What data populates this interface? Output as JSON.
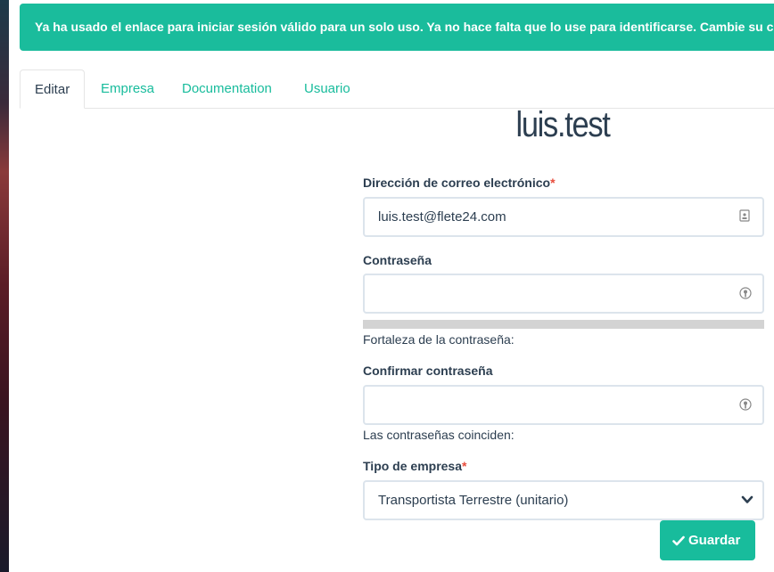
{
  "alert": {
    "text": "Ya ha usado el enlace para iniciar sesión válido para un solo uso. Ya no hace falta que lo use para identificarse. Cambie su clave, po"
  },
  "tabs": [
    {
      "label": "Editar",
      "active": true
    },
    {
      "label": "Empresa",
      "active": false
    },
    {
      "label": "Documentation",
      "active": false
    },
    {
      "label": "Usuario",
      "active": false
    }
  ],
  "page_title": "luis.test",
  "form": {
    "email": {
      "label": "Dirección de correo electrónico",
      "required_mark": "*",
      "value": "luis.test@flete24.com",
      "icon": "contact-card-icon"
    },
    "password": {
      "label": "Contraseña",
      "value": "",
      "icon": "password-key-icon",
      "strength_label": "Fortaleza de la contraseña:",
      "strength": 0
    },
    "confirm_password": {
      "label": "Confirmar contraseña",
      "value": "",
      "icon": "password-key-icon",
      "match_label": "Las contraseñas coinciden:"
    },
    "company_type": {
      "label": "Tipo de empresa",
      "required_mark": "*",
      "selected": "Transportista Terrestre (unitario)",
      "icon": "chevron-down-icon"
    }
  },
  "save_button": {
    "label": "Guardar",
    "icon": "checkmark-icon"
  },
  "colors": {
    "accent": "#18bc9c",
    "heading": "#2c3e50",
    "required": "#e74c3c"
  }
}
